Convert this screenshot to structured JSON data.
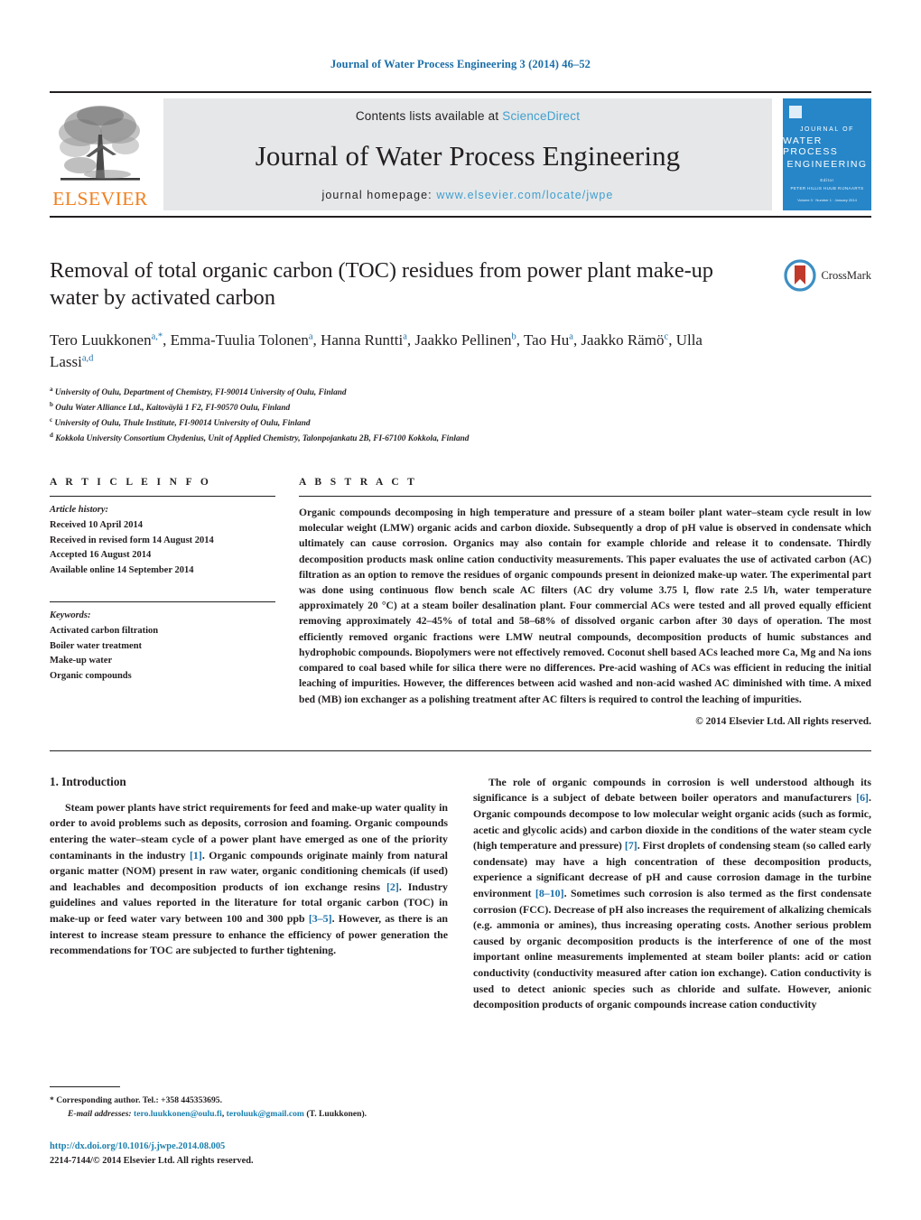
{
  "running_head": "Journal of Water Process Engineering 3 (2014) 46–52",
  "masthead": {
    "contents_text": "Contents lists available at ",
    "sciencedirect": "ScienceDirect",
    "journal_title": "Journal of Water Process Engineering",
    "homepage_label": "journal homepage: ",
    "homepage_url": "www.elsevier.com/locate/jwpe",
    "publisher": "ELSEVIER",
    "cover": {
      "line1": "JOURNAL OF",
      "line2": "WATER PROCESS",
      "line3": "ENGINEERING",
      "sub1": "Editor",
      "sub2": "PETER HILLIS   HUUB RIJNAARTS",
      "footer": "Volume 3 · Number 1 · January 2014"
    },
    "band_color": "#e6e7e8",
    "cover_color": "#2786c8",
    "link_color": "#3f9fd0",
    "elsevier_orange": "#f08020"
  },
  "article": {
    "title": "Removal of total organic carbon (TOC) residues from power plant make-up water by activated carbon",
    "crossmark_label": "CrossMark",
    "authors_line1": "Tero Luukkonen",
    "authors": [
      {
        "name": "Tero Luukkonen",
        "sup": "a,*"
      },
      {
        "name": "Emma-Tuulia Tolonen",
        "sup": "a"
      },
      {
        "name": "Hanna Runtti",
        "sup": "a"
      },
      {
        "name": "Jaakko Pellinen",
        "sup": "b"
      },
      {
        "name": "Tao Hu",
        "sup": "a"
      },
      {
        "name": "Jaakko Rämö",
        "sup": "c"
      },
      {
        "name": "Ulla Lassi",
        "sup": "a,d"
      }
    ],
    "affiliations": [
      {
        "mark": "a",
        "text": "University of Oulu, Department of Chemistry, FI-90014 University of Oulu, Finland"
      },
      {
        "mark": "b",
        "text": "Oulu Water Alliance Ltd., Kaitoväylä 1 F2, FI-90570 Oulu, Finland"
      },
      {
        "mark": "c",
        "text": "University of Oulu, Thule Institute, FI-90014 University of Oulu, Finland"
      },
      {
        "mark": "d",
        "text": "Kokkola University Consortium Chydenius, Unit of Applied Chemistry, Talonpojankatu 2B, FI-67100 Kokkola, Finland"
      }
    ]
  },
  "article_info": {
    "label": "A R T I C L E    I N F O",
    "history_heading": "Article history:",
    "history": [
      "Received 10 April 2014",
      "Received in revised form 14 August 2014",
      "Accepted 16 August 2014",
      "Available online 14 September 2014"
    ],
    "keywords_heading": "Keywords:",
    "keywords": [
      "Activated carbon filtration",
      "Boiler water treatment",
      "Make-up water",
      "Organic compounds"
    ]
  },
  "abstract": {
    "label": "A B S T R A C T",
    "text": "Organic compounds decomposing in high temperature and pressure of a steam boiler plant water–steam cycle result in low molecular weight (LMW) organic acids and carbon dioxide. Subsequently a drop of pH value is observed in condensate which ultimately can cause corrosion. Organics may also contain for example chloride and release it to condensate. Thirdly decomposition products mask online cation conductivity measurements. This paper evaluates the use of activated carbon (AC) filtration as an option to remove the residues of organic compounds present in deionized make-up water. The experimental part was done using continuous flow bench scale AC filters (AC dry volume 3.75 l, flow rate 2.5 l/h, water temperature approximately 20 °C) at a steam boiler desalination plant. Four commercial ACs were tested and all proved equally efficient removing approximately 42–45% of total and 58–68% of dissolved organic carbon after 30 days of operation. The most efficiently removed organic fractions were LMW neutral compounds, decomposition products of humic substances and hydrophobic compounds. Biopolymers were not effectively removed. Coconut shell based ACs leached more Ca, Mg and Na ions compared to coal based while for silica there were no differences. Pre-acid washing of ACs was efficient in reducing the initial leaching of impurities. However, the differences between acid washed and non-acid washed AC diminished with time. A mixed bed (MB) ion exchanger as a polishing treatment after AC filters is required to control the leaching of impurities.",
    "copyright": "© 2014 Elsevier Ltd. All rights reserved."
  },
  "introduction": {
    "heading": "1. Introduction",
    "left_para_1a": "Steam power plants have strict requirements for feed and make-up water quality in order to avoid problems such as deposits, corrosion and foaming. Organic compounds entering the water–steam cycle of a power plant have emerged as one of the priority contaminants in the industry ",
    "left_ref_1": "[1]",
    "left_para_1b": ". Organic compounds originate mainly from natural organic matter (NOM) present in raw water, organic conditioning chemicals (if used) and leachables and decomposition products of ion exchange resins ",
    "left_ref_2": "[2]",
    "left_para_1c": ". Industry guidelines and values reported in the literature for total organic carbon (TOC) in make-up or feed water vary between 100 and 300 ppb ",
    "left_ref_3": "[3–5]",
    "left_para_1d": ". However, as there is an interest to increase steam pressure to enhance the efficiency of power generation the recommendations for TOC are subjected to further tightening.",
    "right_para_1a": "The role of organic compounds in corrosion is well understood although its significance is a subject of debate between boiler operators and manufacturers ",
    "right_ref_1": "[6]",
    "right_para_1b": ". Organic compounds decompose to low molecular weight organic acids (such as formic, acetic and glycolic acids) and carbon dioxide in the conditions of the water steam cycle (high temperature and pressure) ",
    "right_ref_2": "[7]",
    "right_para_1c": ". First droplets of condensing steam (so called early condensate) may have a high concentration of these decomposition products, experience a significant decrease of pH and cause corrosion damage in the turbine environment ",
    "right_ref_3": "[8–10]",
    "right_para_1d": ". Sometimes such corrosion is also termed as the first condensate corrosion (FCC). Decrease of pH also increases the requirement of alkalizing chemicals (e.g. ammonia or amines), thus increasing operating costs. Another serious problem caused by organic decomposition products is the interference of one of the most important online measurements implemented at steam boiler plants: acid or cation conductivity (conductivity measured after cation ion exchange). Cation conductivity is used to detect anionic species such as chloride and sulfate. However, anionic decomposition products of organic compounds increase cation conductivity"
  },
  "footnotes": {
    "corresponding": "* Corresponding author. Tel.: +358 445353695.",
    "email_label": "E-mail addresses:",
    "email_1": "tero.luukkonen@oulu.fi",
    "email_2": "teroluuk@gmail.com",
    "email_suffix": "(T. Luukkonen).",
    "doi": "http://dx.doi.org/10.1016/j.jwpe.2014.08.005",
    "issn": "2214-7144/© 2014 Elsevier Ltd. All rights reserved."
  }
}
